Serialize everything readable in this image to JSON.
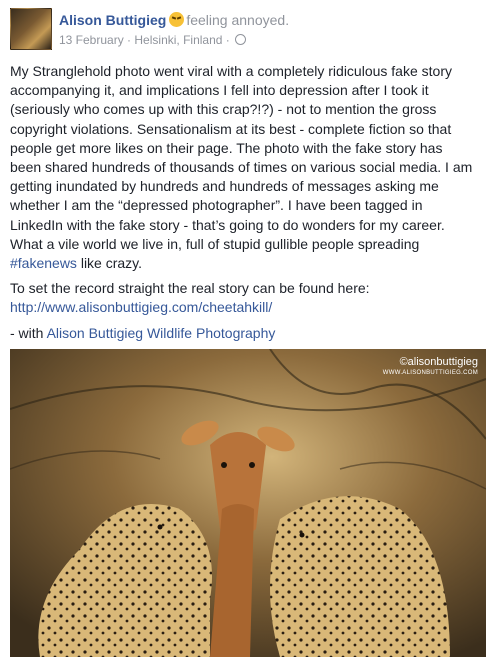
{
  "post": {
    "author": "Alison Buttigieg",
    "feeling": "feeling annoyed.",
    "date": "13 February",
    "location": "Helsinki, Finland",
    "separator": "·",
    "body_lines": [
      "My Stranglehold photo went viral with a completely ridiculous fake story",
      "accompanying it, and implications I fell into depression after I took it",
      "(seriously who comes up with this crap?!?) - not to mention the gross",
      "copyright violations. Sensationalism at its best - complete fiction so that",
      "people get more likes on their page. The photo with the fake story has",
      "been shared hundreds of thousands of times on various social media. I am",
      "getting inundated by hundreds and hundreds of messages asking me",
      "whether I am the “depressed photographer”. I have been tagged in",
      "LinkedIn with the fake story - that’s going to do wonders for my career.",
      "What a vile world we live in, full of stupid gullible people spreading"
    ],
    "hashtag": "#fakenews",
    "hashtag_suffix": " like crazy.",
    "record_text": "To set the record straight the real story can be found here:",
    "record_link": "http://www.alisonbuttigieg.com/cheetahkill/",
    "with_prefix": "- with ",
    "with_page": "Alison Buttigieg Wildlife Photography"
  },
  "photo": {
    "watermark_brand": "©alisonbuttigieg",
    "watermark_url": "WWW.ALISONBUTTIGIEG.COM",
    "colors": {
      "background": "#8b6a3c",
      "impala": "#b8733a",
      "cheetah": "#d9b878",
      "spots": "#2a1e12"
    }
  },
  "icons": {
    "emoji": "annoyed-face-icon",
    "privacy": "globe-icon"
  }
}
